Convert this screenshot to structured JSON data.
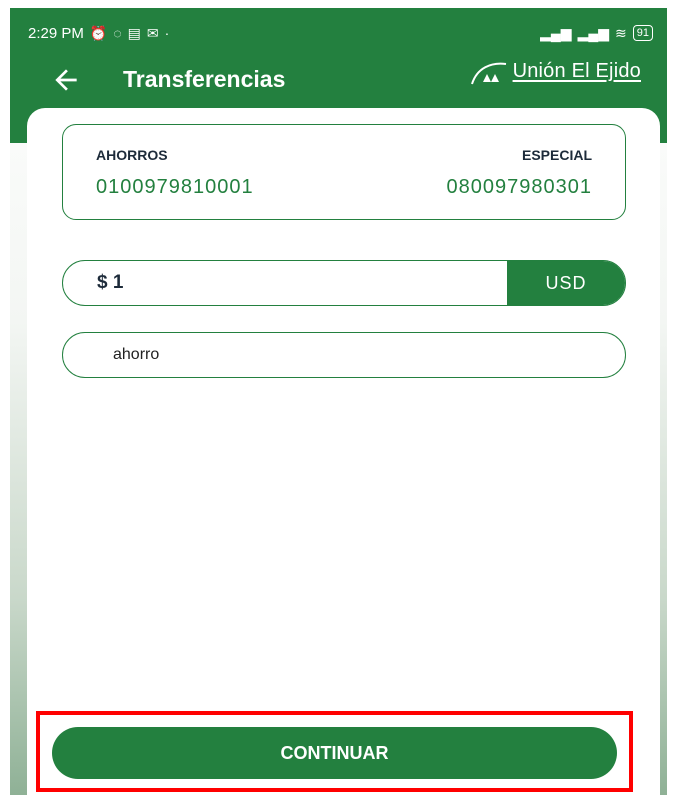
{
  "status_bar": {
    "time": "2:29 PM",
    "left_icons": [
      "alarm-icon",
      "whatsapp-icon",
      "message-icon",
      "gmail-icon",
      "dot-icon"
    ],
    "right_icons": [
      "signal-icon",
      "signal-icon",
      "wifi-icon"
    ],
    "battery": "91"
  },
  "app_bar": {
    "title": "Transferencias",
    "back_icon": "arrow-left-icon",
    "logo_text": "Unión El Ejido"
  },
  "accounts": {
    "origin": {
      "type": "AHORROS",
      "number": "0100979810001"
    },
    "destination": {
      "type": "ESPECIAL",
      "number": "080097980301"
    }
  },
  "amount": {
    "value": "$ 1",
    "currency": "USD"
  },
  "concept": {
    "value": "ahorro"
  },
  "actions": {
    "continue_label": "CONTINUAR"
  },
  "colors": {
    "primary": "#23803f",
    "highlight": "#ff0000",
    "text_dark": "#1d2b3a"
  }
}
